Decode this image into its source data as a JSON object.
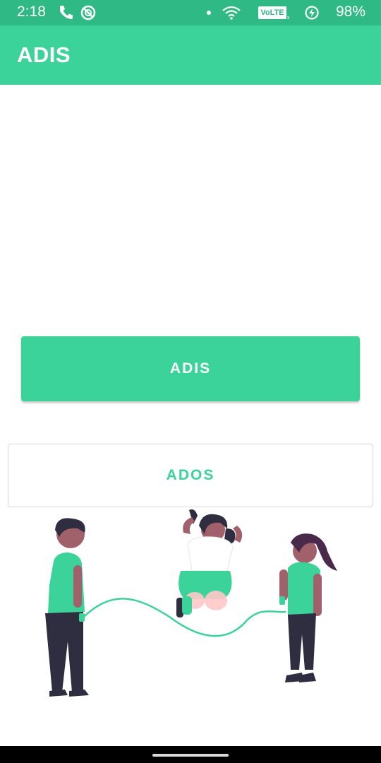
{
  "status_bar": {
    "time": "2:18",
    "network_badge": "VoLTE",
    "battery": "98%",
    "left_icons": [
      "phone-icon",
      "no-disturb-icon"
    ],
    "right_icons": [
      "dot-icon",
      "wifi-icon",
      "signal-icon",
      "battery-saver-icon"
    ]
  },
  "app_bar": {
    "title": "ADIS"
  },
  "buttons": {
    "adis_label": "ADIS",
    "ados_label": "ADOS"
  },
  "colors": {
    "accent": "#3cd39b",
    "status_bar": "#2fb984",
    "skin_dark": "#a0616a",
    "hair": "#2f2e41",
    "shirt": "#3cd39b"
  },
  "illustration": {
    "name": "children-jumping-rope"
  }
}
